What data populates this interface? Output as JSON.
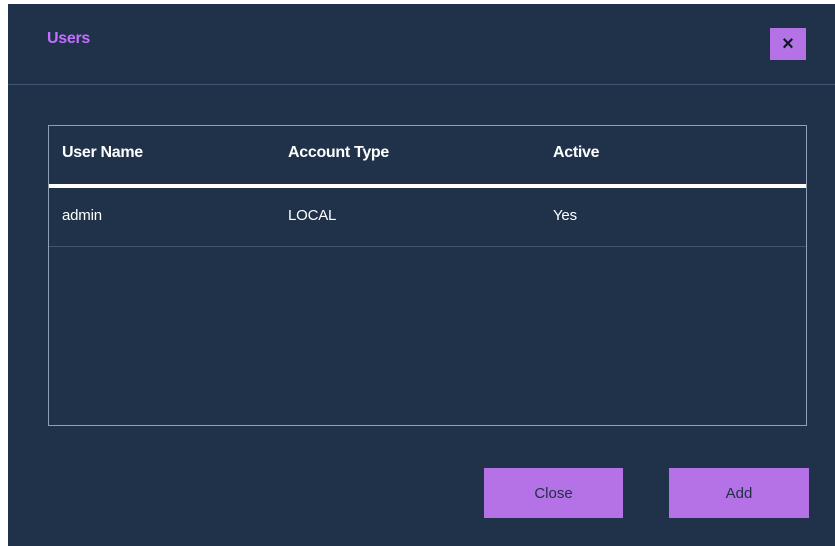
{
  "dialog": {
    "title": "Users",
    "close_icon": "×"
  },
  "table": {
    "columns": [
      "User Name",
      "Account Type",
      "Active"
    ],
    "rows": [
      [
        "admin",
        "LOCAL",
        "Yes"
      ]
    ]
  },
  "buttons": {
    "close_label": "Close",
    "add_label": "Add"
  },
  "colors": {
    "background": "#1f3249",
    "accent": "#b472e6",
    "title": "#c070ff"
  }
}
